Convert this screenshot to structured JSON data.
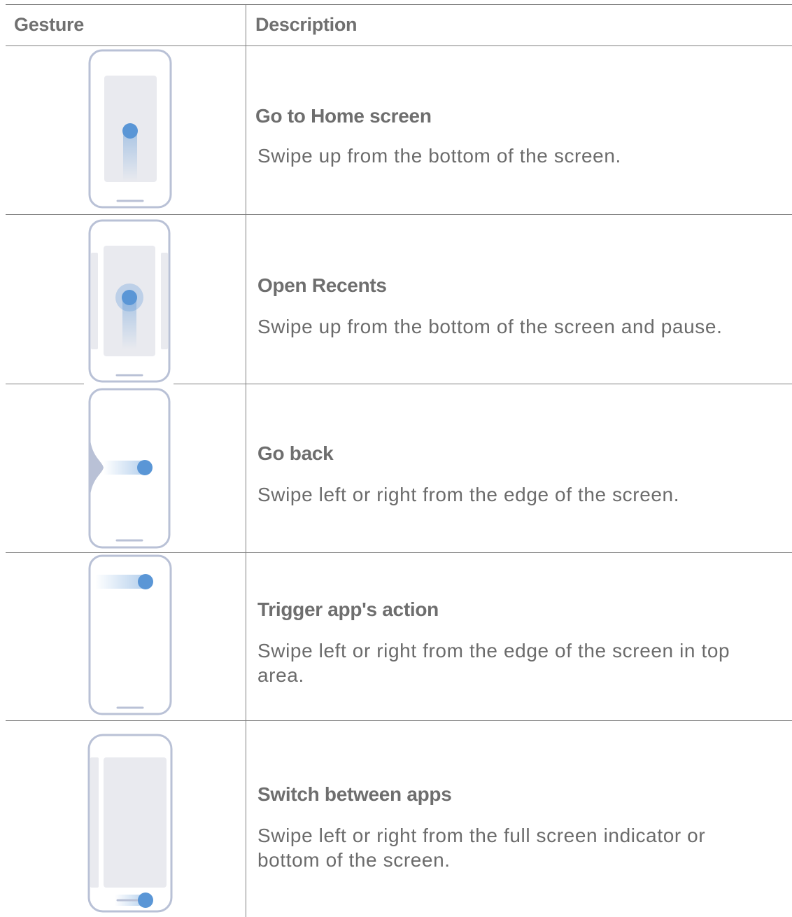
{
  "table": {
    "headers": {
      "gesture": "Gesture",
      "description": "Description"
    },
    "rows": [
      {
        "title": "Go to Home screen",
        "text": "Swipe up from the bottom of the screen.",
        "icon": "swipe-up-home-icon"
      },
      {
        "title": "Open Recents",
        "text": "Swipe up from the bottom of the screen and pause.",
        "icon": "swipe-up-pause-recents-icon"
      },
      {
        "title": "Go back",
        "text": "Swipe left or right from the edge of the screen.",
        "icon": "swipe-edge-back-icon"
      },
      {
        "title": "Trigger app's action",
        "text": "Swipe left or right from the edge of the screen in top area.",
        "icon": "swipe-edge-top-icon"
      },
      {
        "title": "Switch between apps",
        "text": "Swipe left or right from the full screen indicator or bottom of the screen.",
        "icon": "swipe-indicator-switch-icon"
      }
    ]
  },
  "colors": {
    "phone_outline": "#b9c1d6",
    "screen_fill": "#e9eaef",
    "touch_dot": "#5a96d6",
    "rule_line": "#7f7f7f"
  }
}
